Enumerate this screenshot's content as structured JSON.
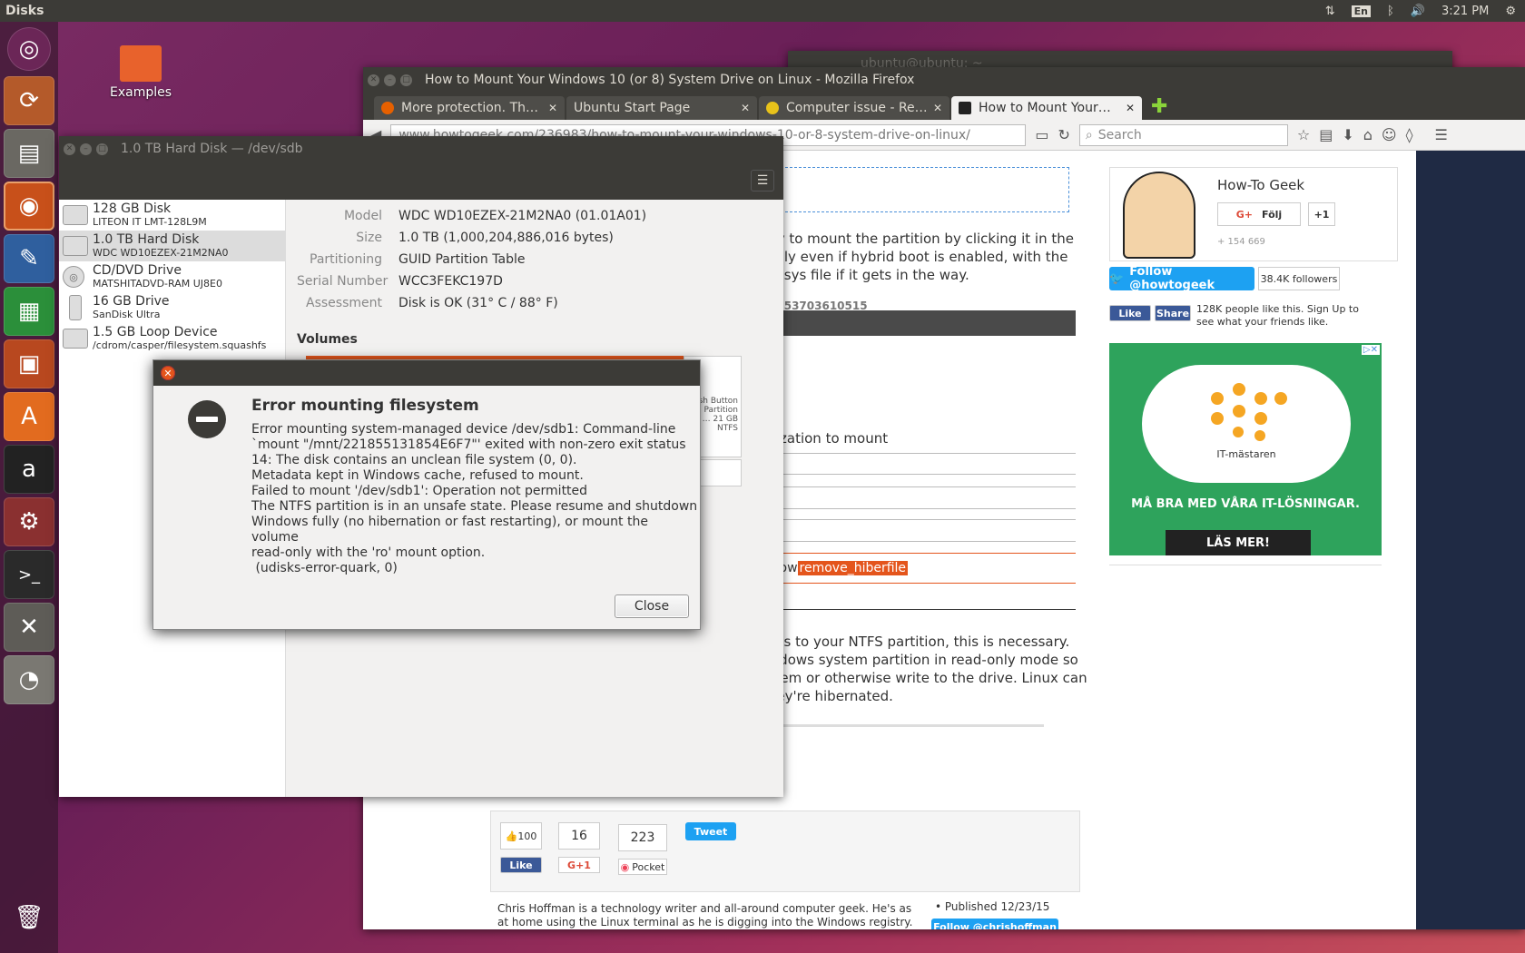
{
  "topbar": {
    "app_title": "Disks",
    "lang": "En",
    "time": "3:21 PM"
  },
  "desktop_icon": {
    "label": "Examples"
  },
  "terminal_window": {
    "title": "ubuntu@ubuntu: ~"
  },
  "firefox": {
    "title": "How to Mount Your Windows 10 (or 8) System Drive on Linux - Mozilla Firefox",
    "tabs": [
      {
        "label": "More protection. Th…",
        "close": "✕"
      },
      {
        "label": "Ubuntu Start Page",
        "close": "✕"
      },
      {
        "label": "Computer issue - Re…",
        "close": "✕"
      },
      {
        "label": "How to Mount Your…",
        "close": "✕"
      }
    ],
    "url": "www.howtogeek.com/236983/how-to-mount-your-windows-10-or-8-system-drive-on-linux/",
    "search_placeholder": "Search",
    "article": {
      "lines_top": [
        "y try to mount the partition by clicking it in the",
        "rmally even if hybrid boot is enabled, with the",
        "rfile.sys file if it gets in the way."
      ],
      "dark_text": "ser 153703610515",
      "auth_text": "horization to mount",
      "cmd_prefix": "s-show",
      "cmd_highlight": "remove_hiberfile",
      "lines_bottom": [
        "ccess to your NTFS partition, this is necessary.",
        "Windows system partition in read-only mode so",
        "e them or otherwise write to the drive. Linux can",
        "f they're hibernated."
      ],
      "share": {
        "like_count": "100",
        "gplus_count": "16",
        "pocket_count": "223",
        "like": "Like",
        "gplus": "G+1",
        "pocket": "Pocket",
        "tweet": "Tweet"
      },
      "bio": "Chris Hoffman is a technology writer and all-around computer geek. He's as at home using the Linux terminal as he is digging into the Windows registry. Connect with him on Google+",
      "published": "• Published 12/23/15",
      "follow_author": "Follow @chrishoffman"
    },
    "sidebar": {
      "brand": "How-To Geek",
      "follow": "Följ",
      "plus_one": "+1",
      "gplus_count": "+ 154 669",
      "twitter_follow": "Follow @howtogeek",
      "twitter_count": "38.4K followers",
      "fb_like": "Like",
      "fb_share": "Share",
      "fb_text": "128K people like this. Sign Up to see what your friends like.",
      "ad_brand": "IT-mästaren",
      "ad_slogan": "MÅ BRA MED VÅRA IT-LÖSNINGAR.",
      "ad_button": "LÄS MER!"
    }
  },
  "disks": {
    "title": "1.0 TB Hard Disk — /dev/sdb",
    "drives": [
      {
        "name": "128 GB Disk",
        "sub": "LITEON IT LMT-128L9M"
      },
      {
        "name": "1.0 TB Hard Disk",
        "sub": "WDC WD10EZEX-21M2NA0"
      },
      {
        "name": "CD/DVD Drive",
        "sub": "MATSHITADVD-RAM UJ8E0"
      },
      {
        "name": "16 GB Drive",
        "sub": "SanDisk Ultra"
      },
      {
        "name": "1.5 GB Loop Device",
        "sub": "/cdrom/casper/filesystem.squashfs"
      }
    ],
    "props": [
      {
        "label": "Model",
        "value": "WDC WD10EZEX-21M2NA0 (01.01A01)"
      },
      {
        "label": "Size",
        "value": "1.0 TB (1,000,204,886,016 bytes)"
      },
      {
        "label": "Partitioning",
        "value": "GUID Partition Table"
      },
      {
        "label": "Serial Number",
        "value": "WCC3FEKC197D"
      },
      {
        "label": "Assessment",
        "value": "Disk is OK (31° C / 88° F)"
      }
    ],
    "volumes_heading": "Volumes",
    "free_volume": "Push Button … Partition 2: … 21 GB NTFS"
  },
  "error_dialog": {
    "title": "Error mounting filesystem",
    "message_lines": [
      "Error mounting system-managed device /dev/sdb1: Command-line",
      "`mount \"/mnt/221855131854E6F7\"' exited with non-zero exit status",
      "14: The disk contains an unclean file system (0, 0).",
      "Metadata kept in Windows cache, refused to mount.",
      "Failed to mount '/dev/sdb1': Operation not permitted",
      "The NTFS partition is in an unsafe state. Please resume and shutdown",
      "Windows fully (no hibernation or fast restarting), or mount the",
      "volume",
      "read-only with the 'ro' mount option.",
      " (udisks-error-quark, 0)"
    ],
    "close_label": "Close"
  },
  "colors": {
    "ubuntu_orange": "#e4551c",
    "panel": "#3c3b37",
    "twitter": "#1da1f2",
    "facebook": "#3b5998",
    "ad_green": "#2ea35c"
  }
}
